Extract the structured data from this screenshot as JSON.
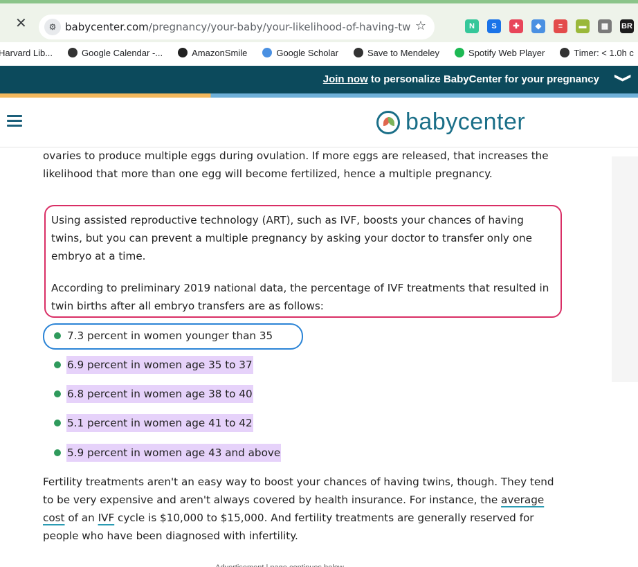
{
  "browser": {
    "close_glyph": "✕",
    "site_info_icon": "tune-icon",
    "url_domain": "babycenter.com",
    "url_path": "/pregnancy/your-baby/your-likelihood-of-having-twins-...",
    "star_glyph": "☆",
    "extensions": [
      {
        "label": "N",
        "color": "#35c79a"
      },
      {
        "label": "S",
        "color": "#1a73e8"
      },
      {
        "label": "✚",
        "color": "#e8455a"
      },
      {
        "label": "◆",
        "color": "#4a90e2"
      },
      {
        "label": "≡",
        "color": "#e34b4b"
      },
      {
        "label": "▬",
        "color": "#9ab83a"
      },
      {
        "label": "▦",
        "color": "#7a7a7a"
      },
      {
        "label": "BR",
        "color": "#1c1c1c"
      }
    ]
  },
  "bookmarks": [
    {
      "label": "Harvard Lib...",
      "icon": "none",
      "color": ""
    },
    {
      "label": "Google Calendar -...",
      "icon": "globe-icon",
      "color": "#333"
    },
    {
      "label": "AmazonSmile",
      "icon": "amazon-icon",
      "color": "#222"
    },
    {
      "label": "Google Scholar",
      "icon": "scholar-icon",
      "color": "#4a90e2"
    },
    {
      "label": "Save to Mendeley",
      "icon": "globe-icon",
      "color": "#333"
    },
    {
      "label": "Spotify Web Player",
      "icon": "spotify-icon",
      "color": "#1db954"
    },
    {
      "label": "Timer: < 1.0h c",
      "icon": "globe-icon",
      "color": "#333"
    }
  ],
  "banner": {
    "link": "Join now",
    "rest": " to personalize BabyCenter for your pregnancy",
    "chevron": "❯"
  },
  "header": {
    "logo_text": "babycenter"
  },
  "article": {
    "p1": "ovaries to produce multiple eggs during ovulation. If more eggs are released, that increases the likelihood that more than one egg will become fertilized, hence a multiple pregnancy.",
    "p2": "Using assisted reproductive technology (ART), such as IVF, boosts your chances of having twins, but you can prevent a multiple pregnancy by asking your doctor to transfer only one embryo at a time.",
    "p3": "According to preliminary 2019 national data, the percentage of IVF treatments that resulted in twin births after all embryo transfers are as follows:",
    "list": [
      "7.3 percent in women younger than 35",
      "6.9 percent in women age 35 to 37",
      "6.8 percent in women age 38 to 40",
      "5.1 percent in women age 41 to 42",
      "5.9 percent in women age 43 and above"
    ],
    "p4_a": "Fertility treatments aren't an easy way to boost your chances of having twins, though. They tend to be very expensive and aren't always covered by health insurance. For instance, the ",
    "p4_link1": "average cost",
    "p4_b": " of an ",
    "p4_link2": "IVF",
    "p4_c": " cycle is $10,000 to $15,000. And fertility treatments are generally reserved for people who have been diagnosed with infertility.",
    "ad_note": "Advertisement | page continues below"
  }
}
